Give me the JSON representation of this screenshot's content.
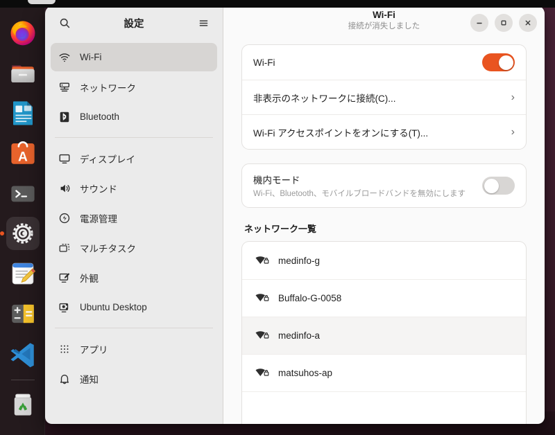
{
  "dock": {
    "items": [
      {
        "name": "firefox",
        "icon": "firefox-icon",
        "active": false
      },
      {
        "name": "files",
        "icon": "files-icon",
        "active": false
      },
      {
        "name": "libreoffice",
        "icon": "libreoffice-writer-icon",
        "active": false
      },
      {
        "name": "app-center",
        "icon": "ubuntu-app-center-icon",
        "active": false
      },
      {
        "name": "terminal",
        "icon": "terminal-icon",
        "active": false
      },
      {
        "name": "settings",
        "icon": "settings-gear-icon",
        "active": true
      },
      {
        "name": "text-editor",
        "icon": "text-editor-icon",
        "active": false
      },
      {
        "name": "calculator",
        "icon": "calculator-icon",
        "active": false
      },
      {
        "name": "vscode",
        "icon": "vscode-icon",
        "active": false
      },
      {
        "name": "trash",
        "icon": "trash-icon",
        "active": false
      }
    ]
  },
  "sidebar": {
    "title": "設定",
    "search_icon": "search-icon",
    "menu_icon": "hamburger-menu-icon",
    "groups": [
      {
        "items": [
          {
            "label": "Wi-Fi",
            "icon": "wifi-icon",
            "selected": true
          },
          {
            "label": "ネットワーク",
            "icon": "network-icon",
            "selected": false
          },
          {
            "label": "Bluetooth",
            "icon": "bluetooth-icon",
            "selected": false
          }
        ]
      },
      {
        "items": [
          {
            "label": "ディスプレイ",
            "icon": "display-icon",
            "selected": false
          },
          {
            "label": "サウンド",
            "icon": "sound-icon",
            "selected": false
          },
          {
            "label": "電源管理",
            "icon": "power-icon",
            "selected": false
          },
          {
            "label": "マルチタスク",
            "icon": "multitasking-icon",
            "selected": false
          },
          {
            "label": "外観",
            "icon": "appearance-icon",
            "selected": false
          },
          {
            "label": "Ubuntu Desktop",
            "icon": "ubuntu-desktop-icon",
            "selected": false
          }
        ]
      },
      {
        "items": [
          {
            "label": "アプリ",
            "icon": "apps-grid-icon",
            "selected": false
          },
          {
            "label": "通知",
            "icon": "notifications-bell-icon",
            "selected": false
          }
        ]
      }
    ]
  },
  "header": {
    "title": "Wi-Fi",
    "subtitle": "接続が消失しました",
    "minimize_icon": "minimize-icon",
    "maximize_icon": "maximize-icon",
    "close_icon": "close-icon"
  },
  "main": {
    "wifi_card": {
      "rows": [
        {
          "label": "Wi-Fi",
          "type": "toggle",
          "value": "on"
        },
        {
          "label": "非表示のネットワークに接続(C)...",
          "type": "chevron",
          "chevron": "›"
        },
        {
          "label": "Wi-Fi アクセスポイントをオンにする(T)...",
          "type": "chevron",
          "chevron": "›"
        }
      ]
    },
    "airplane_card": {
      "label": "機内モード",
      "sub": "Wi-Fi、Bluetooth、モバイルブロードバンドを無効にします",
      "toggle": "off"
    },
    "networks": {
      "section_title": "ネットワーク一覧",
      "items": [
        {
          "ssid": "medinfo-g",
          "icon": "wifi-secure-icon",
          "hover": false
        },
        {
          "ssid": "Buffalo-G-0058",
          "icon": "wifi-secure-icon",
          "hover": false
        },
        {
          "ssid": "medinfo-a",
          "icon": "wifi-secure-icon",
          "hover": true
        },
        {
          "ssid": "matsuhos-ap",
          "icon": "wifi-secure-icon",
          "hover": false
        },
        {
          "ssid": "",
          "icon": "wifi-secure-icon",
          "hover": false
        }
      ]
    }
  },
  "colors": {
    "accent": "#e95420",
    "window_bg": "#fafafa",
    "sidebar_bg": "#ebebeb",
    "dock_bg": "#241a1d",
    "selected": "#d7d5d3"
  }
}
